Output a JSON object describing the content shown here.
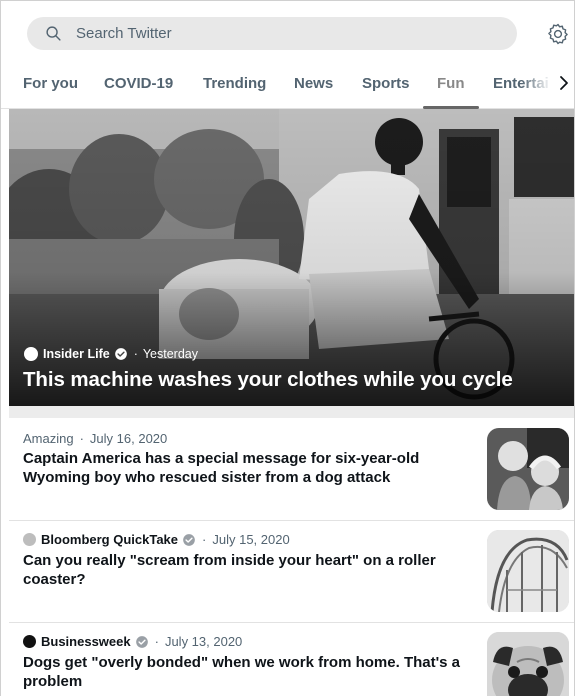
{
  "search": {
    "placeholder": "Search Twitter",
    "icon": "search-icon"
  },
  "settings_icon": "gear-icon",
  "tabs": [
    {
      "label": "For you"
    },
    {
      "label": "COVID-19"
    },
    {
      "label": "Trending"
    },
    {
      "label": "News"
    },
    {
      "label": "Sports"
    },
    {
      "label": "Fun",
      "active": true
    },
    {
      "label": "Entertai"
    }
  ],
  "hero": {
    "source": "Insider Life",
    "verified": true,
    "time": "Yesterday",
    "separator": "·",
    "title": "This machine washes your clothes while you cycle"
  },
  "stories": [
    {
      "source": "Amazing",
      "verified": false,
      "date": "July 16, 2020",
      "title": "Captain America has a special message for six-year-old Wyoming boy who rescued sister from a dog attack",
      "thumbnail": "two-children-photo"
    },
    {
      "source": "Bloomberg QuickTake",
      "verified": true,
      "date": "July 15, 2020",
      "title": "Can you really \"scream from inside your heart\" on a roller coaster?",
      "thumbnail": "roller-coaster-photo"
    },
    {
      "source": "Businessweek",
      "verified": true,
      "date": "July 13, 2020",
      "title": "Dogs get \"overly bonded\" when we work from home. That's a problem",
      "thumbnail": "pug-dog-photo"
    }
  ],
  "separator": "·",
  "colors": {
    "text": "#0f1419",
    "secondary": "#536471",
    "search_bg": "#e8e8e8",
    "divider": "#e2e2e2"
  }
}
